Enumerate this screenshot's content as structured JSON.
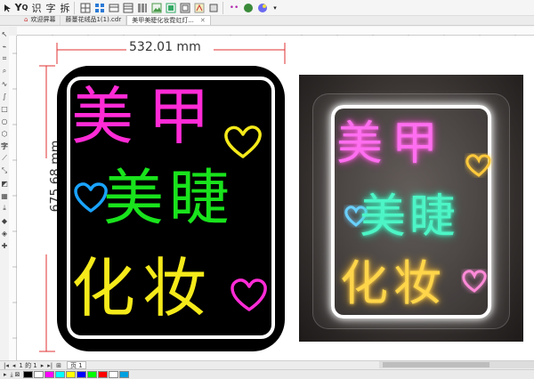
{
  "toolbar": {
    "items": [
      "▸",
      "↙",
      "识",
      "字",
      "拆"
    ]
  },
  "tabs": [
    {
      "label": "欢迎屏幕",
      "active": false
    },
    {
      "label": "藤蔓花绒品1(1).cdr",
      "active": false
    },
    {
      "label": "美甲美睫化妆霓虹灯...",
      "active": true
    }
  ],
  "dimensions": {
    "width_label": "532.01 mm",
    "height_label": "675.68 mm"
  },
  "design": {
    "line1": "美甲",
    "line2": "美睫",
    "line3": "化妆",
    "colors": {
      "line1": "#ff2bd6",
      "line2": "#19e31c",
      "line3": "#f5ea1a",
      "heart_top": "#f5ea1a",
      "heart_left": "#1aa3ff",
      "heart_bottom": "#ff2bd6"
    }
  },
  "photo": {
    "line1": "美甲",
    "line2": "美睫",
    "line3": "化妆",
    "colors": {
      "line1": "#ff6ef0",
      "line2": "#4df5c6",
      "line3": "#ffd54a",
      "heart_top": "#ffc93c",
      "heart_left": "#6ad0ff",
      "heart_bottom": "#ff8ad8"
    }
  },
  "pagebar": {
    "page_of": "1 的 1",
    "page_tab": "页 1"
  },
  "palette": [
    "#000000",
    "#ffffff",
    "#ff00ff",
    "#00ffff",
    "#ffff00",
    "#0000ff",
    "#00ff00",
    "#ff0000",
    "#ffffff",
    "#00a0e0"
  ]
}
